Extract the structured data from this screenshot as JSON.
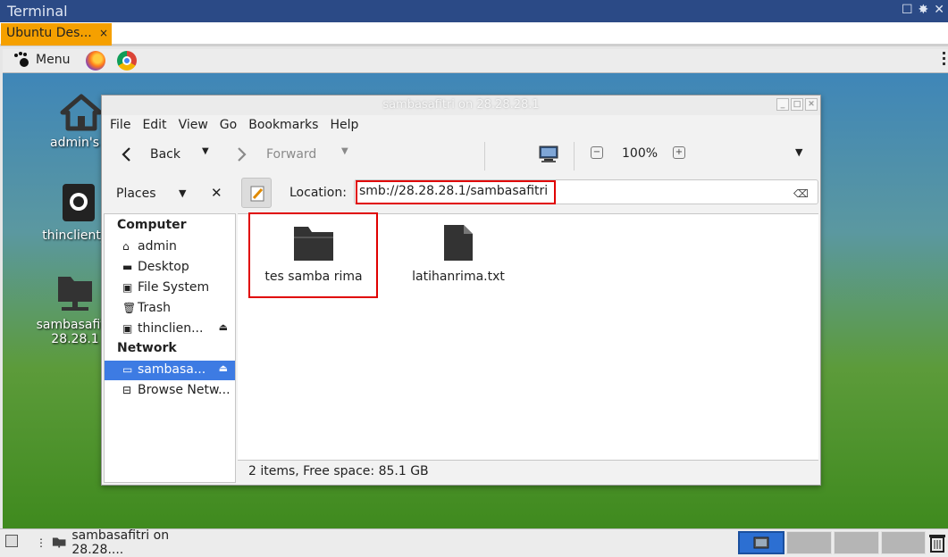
{
  "terminal": {
    "title": "Terminal",
    "tab_label": "Ubuntu Des...",
    "tab_close": "×",
    "controls": [
      "☐",
      "✸",
      "✕"
    ]
  },
  "panel": {
    "menu_label": "Menu"
  },
  "desktop": {
    "icons": [
      {
        "label1": "admin's H",
        "label2": ""
      },
      {
        "label1": "thinclient_d",
        "label2": ""
      },
      {
        "label1": "sambasafitri",
        "label2": "28.28.1"
      }
    ]
  },
  "window": {
    "title": "sambasafitri on 28.28.28.1",
    "menu": [
      "File",
      "Edit",
      "View",
      "Go",
      "Bookmarks",
      "Help"
    ],
    "toolbar": {
      "back": "Back",
      "forward": "Forward",
      "zoom": "100%"
    },
    "places_label": "Places",
    "location_label": "Location:",
    "location_value": "smb://28.28.28.1/sambasafitri",
    "sidebar": {
      "computer_header": "Computer",
      "computer_items": [
        "admin",
        "Desktop",
        "File System",
        "Trash",
        "thinclien..."
      ],
      "network_header": "Network",
      "network_items": [
        "sambasa...",
        "Browse Netw..."
      ]
    },
    "files": [
      {
        "name": "tes samba rima",
        "type": "folder"
      },
      {
        "name": "latihanrima.txt",
        "type": "text-file"
      }
    ],
    "status": "2 items, Free space: 85.1 GB"
  },
  "taskbar": {
    "task_label": "sambasafitri on 28.28...."
  }
}
